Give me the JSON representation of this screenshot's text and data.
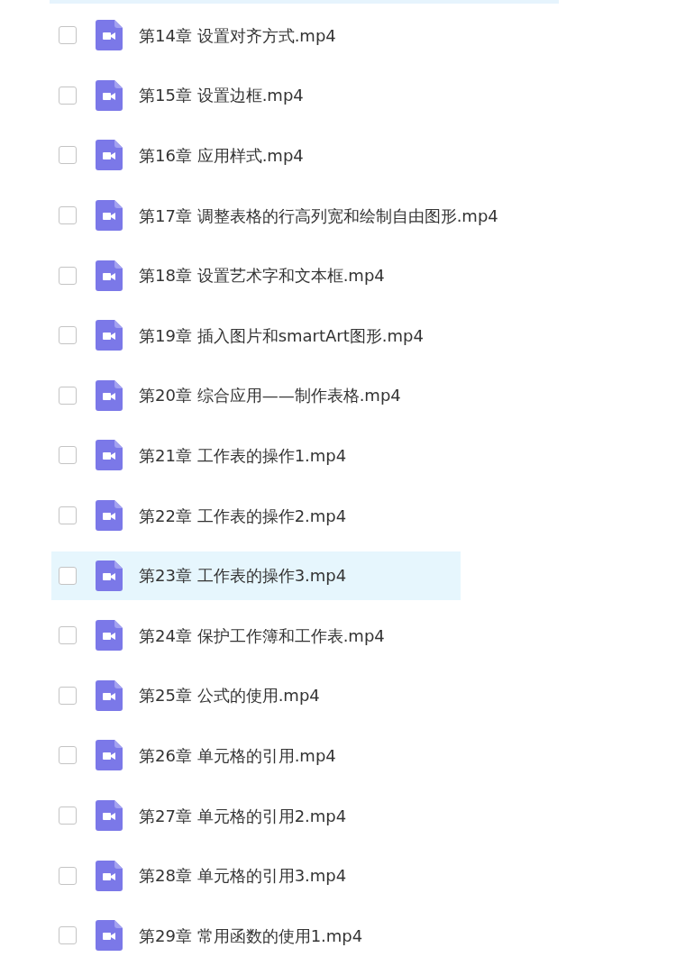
{
  "files": [
    {
      "name": "第14章 设置对齐方式.mp4",
      "checked": false,
      "selected": false
    },
    {
      "name": "第15章 设置边框.mp4",
      "checked": false,
      "selected": false
    },
    {
      "name": "第16章 应用样式.mp4",
      "checked": false,
      "selected": false
    },
    {
      "name": "第17章 调整表格的行高列宽和绘制自由图形.mp4",
      "checked": false,
      "selected": false
    },
    {
      "name": "第18章 设置艺术字和文本框.mp4",
      "checked": false,
      "selected": false
    },
    {
      "name": "第19章 插入图片和smartArt图形.mp4",
      "checked": false,
      "selected": false
    },
    {
      "name": "第20章 综合应用——制作表格.mp4",
      "checked": false,
      "selected": false
    },
    {
      "name": "第21章 工作表的操作1.mp4",
      "checked": false,
      "selected": false
    },
    {
      "name": "第22章 工作表的操作2.mp4",
      "checked": false,
      "selected": false
    },
    {
      "name": "第23章 工作表的操作3.mp4",
      "checked": false,
      "selected": true
    },
    {
      "name": "第24章 保护工作簿和工作表.mp4",
      "checked": false,
      "selected": false
    },
    {
      "name": "第25章 公式的使用.mp4",
      "checked": false,
      "selected": false
    },
    {
      "name": "第26章 单元格的引用.mp4",
      "checked": false,
      "selected": false
    },
    {
      "name": "第27章 单元格的引用2.mp4",
      "checked": false,
      "selected": false
    },
    {
      "name": "第28章 单元格的引用3.mp4",
      "checked": false,
      "selected": false
    },
    {
      "name": "第29章 常用函数的使用1.mp4",
      "checked": false,
      "selected": false
    }
  ]
}
